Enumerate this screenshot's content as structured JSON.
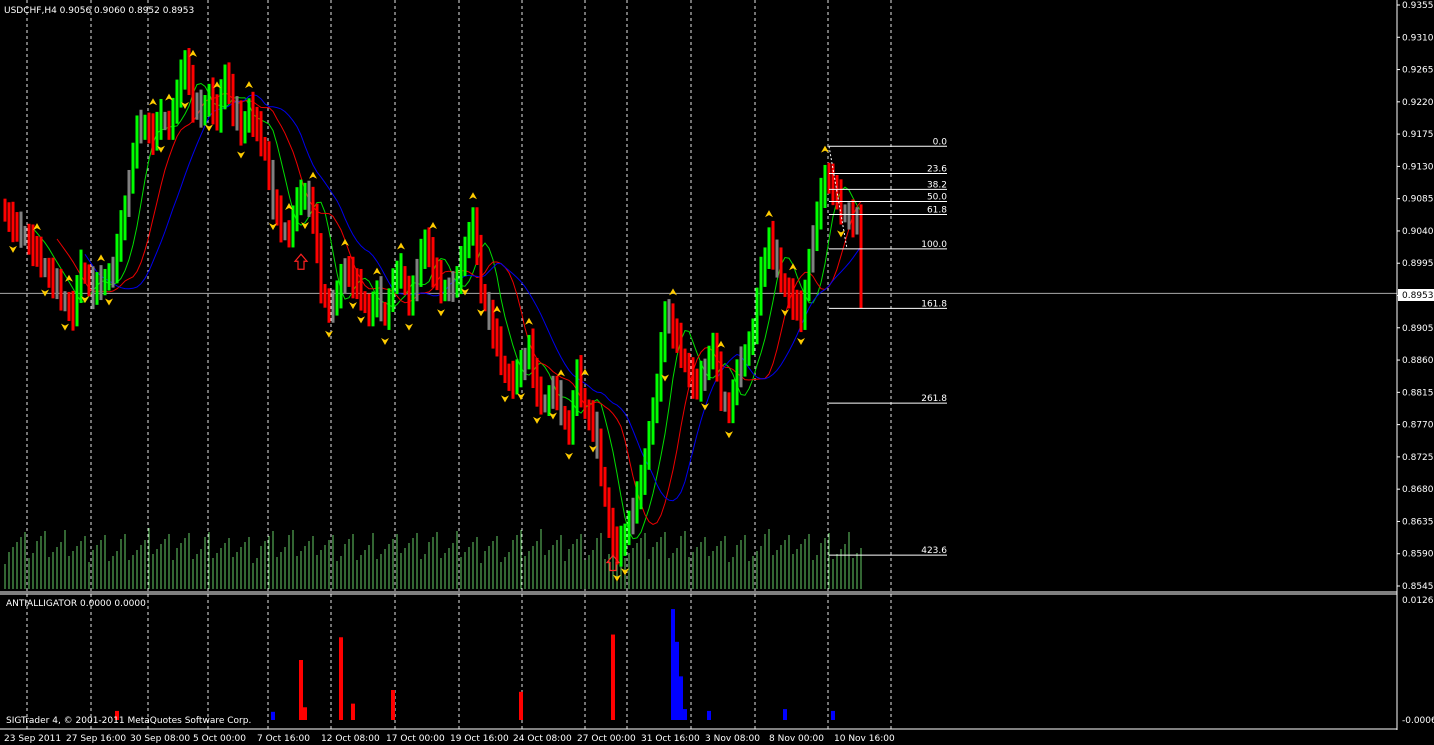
{
  "header": {
    "symbol_line": "USDCHF,H4  0.9056 0.9060 0.8952 0.8953",
    "indicator_line": "ANTIALLIGATOR 0.0000 0.0000",
    "footer_text": "SIGTrader 4, © 2001-2011 MetaQuotes Software Corp."
  },
  "colors": {
    "background": "#000000",
    "bull": "#00FF00",
    "bear": "#FF0000",
    "neutral": "#808080",
    "volume": "#66CC66",
    "lips": "#00DD00",
    "teeth": "#EE0000",
    "jaw": "#0000EE",
    "fractal": "#FFCC00",
    "fib": "#FFFFFF",
    "hist_red": "#FF0000",
    "hist_blue": "#0000FF"
  },
  "chart_data": {
    "type": "candlestick",
    "symbol": "USDCHF",
    "timeframe": "H4",
    "ylim": [
      0.8545,
      0.9355
    ],
    "y_ticks": [
      "0.9355",
      "0.9310",
      "0.9265",
      "0.9220",
      "0.9175",
      "0.9130",
      "0.9085",
      "0.9040",
      "0.8995",
      "0.8950",
      "0.8905",
      "0.8860",
      "0.8815",
      "0.8770",
      "0.8725",
      "0.8680",
      "0.8635",
      "0.8590",
      "0.8545"
    ],
    "current_price": "0.8953",
    "x_ticks": [
      "23 Sep 2011",
      "27 Sep 16:00",
      "30 Sep 08:00",
      "5 Oct 00:00",
      "7 Oct 16:00",
      "12 Oct 08:00",
      "17 Oct 00:00",
      "19 Oct 16:00",
      "24 Oct 08:00",
      "27 Oct 00:00",
      "31 Oct 16:00",
      "3 Nov 08:00",
      "8 Nov 00:00",
      "10 Nov 16:00"
    ],
    "close_keypoints": [
      [
        0,
        0.9065
      ],
      [
        3,
        0.904
      ],
      [
        5,
        0.9035
      ],
      [
        8,
        0.9005
      ],
      [
        12,
        0.897
      ],
      [
        15,
        0.894
      ],
      [
        17,
        0.8925
      ],
      [
        19,
        0.899
      ],
      [
        22,
        0.8955
      ],
      [
        25,
        0.8975
      ],
      [
        27,
        0.8985
      ],
      [
        29,
        0.9045
      ],
      [
        31,
        0.911
      ],
      [
        33,
        0.918
      ],
      [
        35,
        0.919
      ],
      [
        37,
        0.917
      ],
      [
        39,
        0.92
      ],
      [
        41,
        0.9185
      ],
      [
        43,
        0.923
      ],
      [
        45,
        0.928
      ],
      [
        47,
        0.9215
      ],
      [
        49,
        0.9205
      ],
      [
        51,
        0.923
      ],
      [
        53,
        0.9195
      ],
      [
        55,
        0.926
      ],
      [
        57,
        0.921
      ],
      [
        59,
        0.918
      ],
      [
        61,
        0.921
      ],
      [
        63,
        0.918
      ],
      [
        65,
        0.915
      ],
      [
        67,
        0.908
      ],
      [
        69,
        0.9045
      ],
      [
        71,
        0.9035
      ],
      [
        73,
        0.908
      ],
      [
        75,
        0.9095
      ],
      [
        77,
        0.906
      ],
      [
        79,
        0.896
      ],
      [
        81,
        0.893
      ],
      [
        83,
        0.895
      ],
      [
        85,
        0.899
      ],
      [
        87,
        0.897
      ],
      [
        89,
        0.895
      ],
      [
        91,
        0.8925
      ],
      [
        93,
        0.895
      ],
      [
        95,
        0.892
      ],
      [
        97,
        0.897
      ],
      [
        99,
        0.8985
      ],
      [
        101,
        0.894
      ],
      [
        103,
        0.898
      ],
      [
        105,
        0.903
      ],
      [
        107,
        0.8985
      ],
      [
        109,
        0.896
      ],
      [
        111,
        0.896
      ],
      [
        113,
        0.897
      ],
      [
        115,
        0.902
      ],
      [
        117,
        0.9055
      ],
      [
        119,
        0.896
      ],
      [
        121,
        0.892
      ],
      [
        123,
        0.888
      ],
      [
        125,
        0.884
      ],
      [
        127,
        0.883
      ],
      [
        129,
        0.885
      ],
      [
        131,
        0.888
      ],
      [
        133,
        0.881
      ],
      [
        135,
        0.88
      ],
      [
        137,
        0.882
      ],
      [
        139,
        0.879
      ],
      [
        141,
        0.876
      ],
      [
        143,
        0.884
      ],
      [
        145,
        0.879
      ],
      [
        147,
        0.877
      ],
      [
        149,
        0.8705
      ],
      [
        151,
        0.863
      ],
      [
        153,
        0.859
      ],
      [
        155,
        0.862
      ],
      [
        157,
        0.865
      ],
      [
        159,
        0.869
      ],
      [
        161,
        0.876
      ],
      [
        163,
        0.882
      ],
      [
        165,
        0.893
      ],
      [
        167,
        0.89
      ],
      [
        169,
        0.887
      ],
      [
        171,
        0.884
      ],
      [
        173,
        0.882
      ],
      [
        175,
        0.885
      ],
      [
        177,
        0.888
      ],
      [
        179,
        0.881
      ],
      [
        181,
        0.879
      ],
      [
        183,
        0.884
      ],
      [
        185,
        0.887
      ],
      [
        187,
        0.89
      ],
      [
        189,
        0.898
      ],
      [
        191,
        0.903
      ],
      [
        193,
        0.899
      ],
      [
        195,
        0.896
      ],
      [
        197,
        0.894
      ],
      [
        199,
        0.892
      ],
      [
        201,
        0.9
      ],
      [
        203,
        0.906
      ],
      [
        205,
        0.912
      ],
      [
        207,
        0.91
      ],
      [
        209,
        0.907
      ],
      [
        211,
        0.906
      ],
      [
        213,
        0.905
      ],
      [
        214,
        0.8953
      ]
    ],
    "fractals_up_idx": [
      8,
      16,
      24,
      37,
      41,
      47,
      53,
      61,
      71,
      77,
      85,
      93,
      99,
      107,
      117,
      123,
      131,
      139,
      145,
      167,
      179,
      191,
      197,
      205
    ],
    "fractals_down_idx": [
      2,
      10,
      15,
      20,
      26,
      39,
      45,
      51,
      59,
      67,
      75,
      81,
      87,
      89,
      95,
      101,
      109,
      115,
      119,
      125,
      129,
      133,
      137,
      141,
      147,
      153,
      155,
      165,
      175,
      181,
      195,
      199,
      209
    ],
    "signal_arrows": [
      {
        "bar": 74,
        "price": 0.8995
      },
      {
        "bar": 152,
        "price": 0.8575
      }
    ],
    "fibonacci": {
      "x_from_bar": 206,
      "x_to_bar": 235,
      "levels": [
        {
          "label": "0.0",
          "price": 0.9158
        },
        {
          "label": "23.6",
          "price": 0.912
        },
        {
          "label": "38.2",
          "price": 0.9098
        },
        {
          "label": "50.0",
          "price": 0.9081
        },
        {
          "label": "61.8",
          "price": 0.9063
        },
        {
          "label": "100.0",
          "price": 0.9015
        },
        {
          "label": "161.8",
          "price": 0.8932
        },
        {
          "label": "261.8",
          "price": 0.88
        },
        {
          "label": "423.6",
          "price": 0.8588
        }
      ]
    },
    "indicator": {
      "name": "ANTIALLIGATOR",
      "ylim": [
        -0.0006,
        0.0126
      ],
      "y_ticks": [
        "0.0126",
        "-0.0006"
      ],
      "bars": [
        {
          "bar": 28,
          "value": 0.0004,
          "color": "red"
        },
        {
          "bar": 67,
          "value": 0.0003,
          "color": "blue"
        },
        {
          "bar": 74,
          "value": 0.006,
          "color": "red"
        },
        {
          "bar": 75,
          "value": 0.0008,
          "color": "red"
        },
        {
          "bar": 84,
          "value": 0.0085,
          "color": "red"
        },
        {
          "bar": 87,
          "value": 0.0012,
          "color": "red"
        },
        {
          "bar": 97,
          "value": 0.0027,
          "color": "red"
        },
        {
          "bar": 129,
          "value": 0.0025,
          "color": "red"
        },
        {
          "bar": 152,
          "value": 0.0088,
          "color": "red"
        },
        {
          "bar": 167,
          "value": 0.0116,
          "color": "blue"
        },
        {
          "bar": 168,
          "value": 0.008,
          "color": "blue"
        },
        {
          "bar": 169,
          "value": 0.0042,
          "color": "blue"
        },
        {
          "bar": 170,
          "value": 0.0006,
          "color": "blue"
        },
        {
          "bar": 176,
          "value": 0.0004,
          "color": "blue"
        },
        {
          "bar": 195,
          "value": 0.0006,
          "color": "blue"
        },
        {
          "bar": 207,
          "value": 0.0004,
          "color": "blue"
        }
      ]
    }
  }
}
